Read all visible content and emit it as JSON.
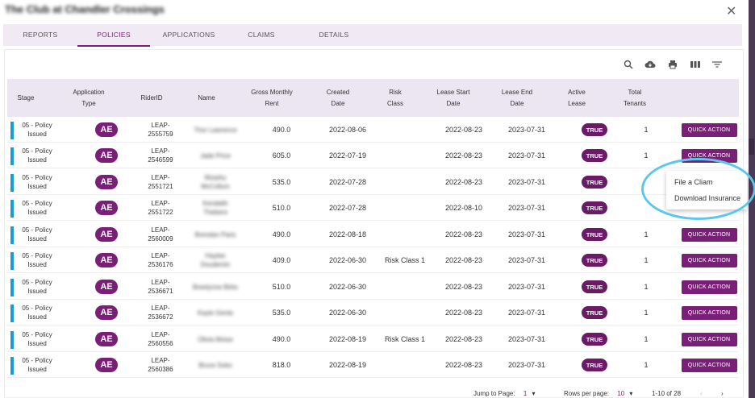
{
  "window": {
    "title": "The Club at Chandler Crossings"
  },
  "tabs": [
    "REPORTS",
    "POLICIES",
    "APPLICATIONS",
    "CLAIMS",
    "DETAILS"
  ],
  "active_tab": "POLICIES",
  "toolbar": {
    "icons": [
      "search-icon",
      "cloud-download-icon",
      "print-icon",
      "columns-icon",
      "filter-icon"
    ]
  },
  "table": {
    "headers": {
      "stage": "Stage",
      "app_type_1": "Application",
      "app_type_2": "Type",
      "rider": "RiderID",
      "name": "Name",
      "rent_1": "Gross Monthly",
      "rent_2": "Rent",
      "created_1": "Created",
      "created_2": "Date",
      "risk_1": "Risk",
      "risk_2": "Class",
      "start_1": "Lease Start",
      "start_2": "Date",
      "end_1": "Lease End",
      "end_2": "Date",
      "active_1": "Active",
      "active_2": "Lease",
      "tenants_1": "Total",
      "tenants_2": "Tenants"
    },
    "rows": [
      {
        "stage_1": "05 - Policy",
        "stage_2": "Issued",
        "type": "AE",
        "rider_1": "LEAP-",
        "rider_2": "2555759",
        "name_1": "Thor Lawrence",
        "name_2": "",
        "rent": "490.0",
        "created": "2022-08-06",
        "risk": "",
        "start": "2022-08-23",
        "end": "2023-07-31",
        "active": "TRUE",
        "tenants": "1",
        "action": "QUICK ACTION"
      },
      {
        "stage_1": "05 - Policy",
        "stage_2": "Issued",
        "type": "AE",
        "rider_1": "LEAP-",
        "rider_2": "2546599",
        "name_1": "Jade Price",
        "name_2": "",
        "rent": "605.0",
        "created": "2022-07-19",
        "risk": "",
        "start": "2022-08-23",
        "end": "2023-07-31",
        "active": "TRUE",
        "tenants": "1",
        "action": "QUICK ACTION"
      },
      {
        "stage_1": "05 - Policy",
        "stage_2": "Issued",
        "type": "AE",
        "rider_1": "LEAP-",
        "rider_2": "2551721",
        "name_1": "Murphy",
        "name_2": "McCollum",
        "rent": "535.0",
        "created": "2022-07-28",
        "risk": "",
        "start": "2022-08-23",
        "end": "2023-07-31",
        "active": "TRUE",
        "tenants": "",
        "action": ""
      },
      {
        "stage_1": "05 - Policy",
        "stage_2": "Issued",
        "type": "AE",
        "rider_1": "LEAP-",
        "rider_2": "2551722",
        "name_1": "Kendalih",
        "name_2": "Thebere",
        "rent": "510.0",
        "created": "2022-07-28",
        "risk": "",
        "start": "2022-08-10",
        "end": "2023-07-31",
        "active": "TRUE",
        "tenants": "",
        "action": ""
      },
      {
        "stage_1": "05 - Policy",
        "stage_2": "Issued",
        "type": "AE",
        "rider_1": "LEAP-",
        "rider_2": "2560009",
        "name_1": "Brendan Paris",
        "name_2": "",
        "rent": "490.0",
        "created": "2022-08-18",
        "risk": "",
        "start": "2022-08-23",
        "end": "2023-07-31",
        "active": "TRUE",
        "tenants": "1",
        "action": "QUICK ACTION"
      },
      {
        "stage_1": "05 - Policy",
        "stage_2": "Issued",
        "type": "AE",
        "rider_1": "LEAP-",
        "rider_2": "2536176",
        "name_1": "Haylee",
        "name_2": "Doudemin",
        "rent": "409.0",
        "created": "2022-06-30",
        "risk": "Risk Class 1",
        "start": "2022-08-23",
        "end": "2023-07-31",
        "active": "TRUE",
        "tenants": "1",
        "action": "QUICK ACTION"
      },
      {
        "stage_1": "05 - Policy",
        "stage_2": "Issued",
        "type": "AE",
        "rider_1": "LEAP-",
        "rider_2": "2536671",
        "name_1": "Breelynne Birks",
        "name_2": "",
        "rent": "510.0",
        "created": "2022-06-30",
        "risk": "",
        "start": "2022-08-23",
        "end": "2023-07-31",
        "active": "TRUE",
        "tenants": "1",
        "action": "QUICK ACTION"
      },
      {
        "stage_1": "05 - Policy",
        "stage_2": "Issued",
        "type": "AE",
        "rider_1": "LEAP-",
        "rider_2": "2536672",
        "name_1": "Kayle Gente",
        "name_2": "",
        "rent": "535.0",
        "created": "2022-06-30",
        "risk": "",
        "start": "2022-08-23",
        "end": "2023-07-31",
        "active": "TRUE",
        "tenants": "1",
        "action": "QUICK ACTION"
      },
      {
        "stage_1": "05 - Policy",
        "stage_2": "Issued",
        "type": "AE",
        "rider_1": "LEAP-",
        "rider_2": "2560556",
        "name_1": "Olivia Moise",
        "name_2": "",
        "rent": "490.0",
        "created": "2022-08-19",
        "risk": "Risk Class 1",
        "start": "2022-08-23",
        "end": "2023-07-31",
        "active": "TRUE",
        "tenants": "1",
        "action": "QUICK ACTION"
      },
      {
        "stage_1": "05 - Policy",
        "stage_2": "Issued",
        "type": "AE",
        "rider_1": "LEAP-",
        "rider_2": "2560386",
        "name_1": "Bruce Soko",
        "name_2": "",
        "rent": "818.0",
        "created": "2022-08-19",
        "risk": "",
        "start": "2022-08-23",
        "end": "2023-07-31",
        "active": "TRUE",
        "tenants": "1",
        "action": "QUICK ACTION"
      }
    ]
  },
  "dropdown_menu": {
    "items": [
      "File a Cliam",
      "Download Insurance"
    ]
  },
  "pagination": {
    "jump_label": "Jump to Page:",
    "jump_value": "1",
    "rows_label": "Rows per page:",
    "rows_value": "10",
    "range": "1-10 of 28"
  }
}
